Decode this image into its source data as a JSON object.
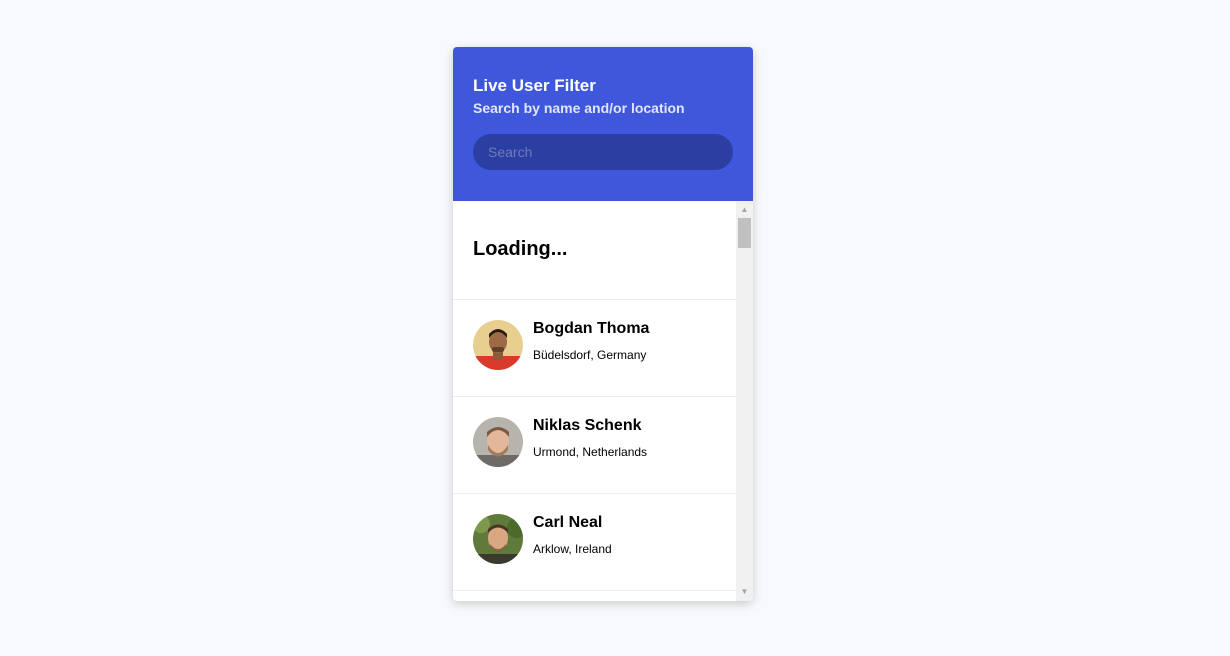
{
  "header": {
    "title": "Live User Filter",
    "subtitle": "Search by name and/or location",
    "search_placeholder": "Search"
  },
  "loading_text": "Loading...",
  "users": [
    {
      "name": "Bogdan Thoma",
      "location": "Büdelsdorf, Germany"
    },
    {
      "name": "Niklas Schenk",
      "location": "Urmond, Netherlands"
    },
    {
      "name": "Carl Neal",
      "location": "Arklow, Ireland"
    }
  ],
  "colors": {
    "accent": "#3e57db",
    "search_bg": "#2b3ea1",
    "page_bg": "#f8f9fd"
  },
  "icons": {
    "scroll_up": "▲",
    "scroll_down": "▼"
  }
}
